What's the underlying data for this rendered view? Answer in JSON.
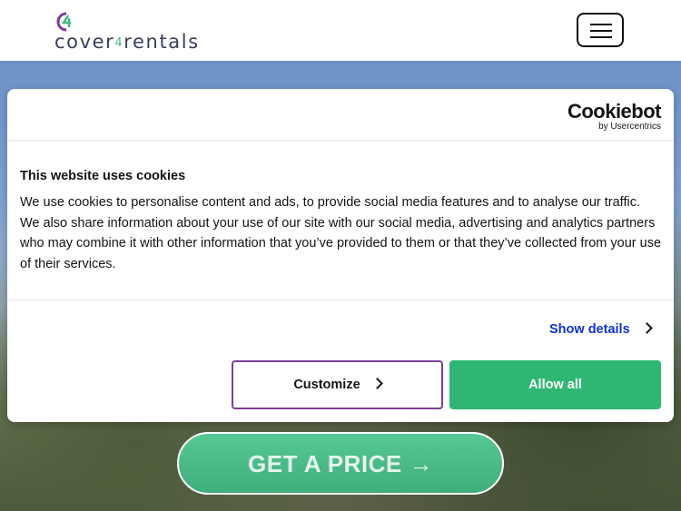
{
  "header": {
    "logo": {
      "text_main": "cover",
      "text_four": "4",
      "text_end": "rentals"
    },
    "menu_icon": "hamburger-menu-icon"
  },
  "cookie_dialog": {
    "brand": {
      "name": "Cookiebot",
      "by": "by Usercentrics"
    },
    "title": "This website uses cookies",
    "body": "We use cookies to personalise content and ads, to provide social media features and to analyse our traffic. We also share information about your use of our site with our social media, advertising and analytics partners who may combine it with other information that you’ve provided to them or that they’ve collected from your use of their services.",
    "show_details": "Show details",
    "customize_label": "Customize",
    "allow_all_label": "Allow all"
  },
  "cta": {
    "label": "GET A PRICE",
    "arrow": "→"
  },
  "colors": {
    "brand_green": "#2fb673",
    "link_blue": "#1032cf",
    "customize_border": "#7b3f97",
    "logo_text": "#3a3f5c"
  }
}
